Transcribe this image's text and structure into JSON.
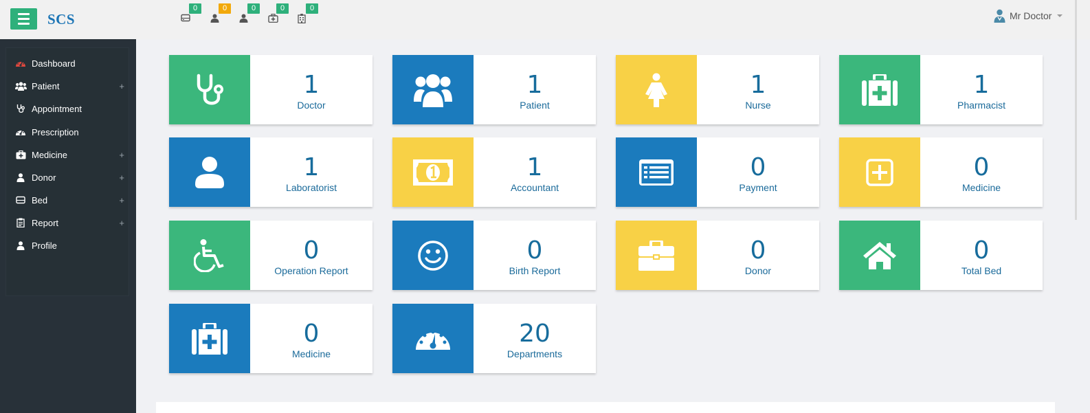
{
  "brand": "SCS",
  "colors": {
    "green": "#3bb77c",
    "blue": "#1b7bbd",
    "yellow": "#f8d146",
    "sidebar": "#283139",
    "accent": "#2eb07b"
  },
  "header": {
    "notifications": [
      {
        "icon": "bed-icon",
        "count": "0",
        "color": "green"
      },
      {
        "icon": "user-icon",
        "count": "0",
        "color": "orange"
      },
      {
        "icon": "user-icon",
        "count": "0",
        "color": "green"
      },
      {
        "icon": "medkit-icon",
        "count": "0",
        "color": "green"
      },
      {
        "icon": "hospital-icon",
        "count": "0",
        "color": "green"
      }
    ],
    "user_name": "Mr Doctor"
  },
  "sidebar": {
    "items": [
      {
        "label": "Dashboard",
        "icon": "dashboard-icon",
        "expandable": false
      },
      {
        "label": "Patient",
        "icon": "users-icon",
        "expandable": true,
        "plus": "+"
      },
      {
        "label": "Appointment",
        "icon": "stethoscope-icon",
        "expandable": false
      },
      {
        "label": "Prescription",
        "icon": "dashboard-icon",
        "expandable": false
      },
      {
        "label": "Medicine",
        "icon": "medkit-icon",
        "expandable": true,
        "plus": "+"
      },
      {
        "label": "Donor",
        "icon": "user-icon",
        "expandable": true,
        "plus": "+"
      },
      {
        "label": "Bed",
        "icon": "bed-icon",
        "expandable": true,
        "plus": "+"
      },
      {
        "label": "Report",
        "icon": "clipboard-icon",
        "expandable": true,
        "plus": "+"
      },
      {
        "label": "Profile",
        "icon": "user-icon",
        "expandable": false
      }
    ]
  },
  "cards": [
    {
      "value": "1",
      "label": "Doctor",
      "color": "green",
      "icon": "stethoscope-icon"
    },
    {
      "value": "1",
      "label": "Patient",
      "color": "blue",
      "icon": "users-icon"
    },
    {
      "value": "1",
      "label": "Nurse",
      "color": "yellow",
      "icon": "female-icon"
    },
    {
      "value": "1",
      "label": "Pharmacist",
      "color": "green",
      "icon": "medkit-icon"
    },
    {
      "value": "1",
      "label": "Laboratorist",
      "color": "blue",
      "icon": "user-icon"
    },
    {
      "value": "1",
      "label": "Accountant",
      "color": "yellow",
      "icon": "money-icon"
    },
    {
      "value": "0",
      "label": "Payment",
      "color": "blue",
      "icon": "list-alt-icon"
    },
    {
      "value": "0",
      "label": "Medicine",
      "color": "yellow",
      "icon": "plus-square-icon"
    },
    {
      "value": "0",
      "label": "Operation Report",
      "color": "green",
      "icon": "wheelchair-icon"
    },
    {
      "value": "0",
      "label": "Birth Report",
      "color": "blue",
      "icon": "smile-icon"
    },
    {
      "value": "0",
      "label": "Donor",
      "color": "yellow",
      "icon": "briefcase-icon"
    },
    {
      "value": "0",
      "label": "Total Bed",
      "color": "green",
      "icon": "home-icon"
    },
    {
      "value": "0",
      "label": "Medicine",
      "color": "blue",
      "icon": "medkit-icon"
    },
    {
      "value": "20",
      "label": "Departments",
      "color": "blue",
      "icon": "dashboard-icon"
    }
  ]
}
